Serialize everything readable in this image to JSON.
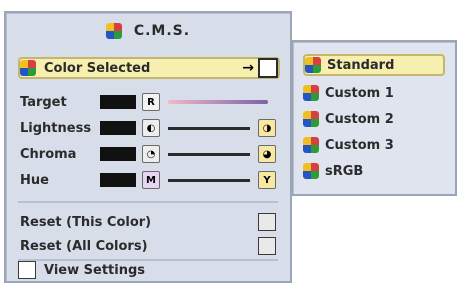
{
  "cms": {
    "title": "C.M.S.",
    "color_selected_label": "Color Selected",
    "arrow": "→",
    "params": [
      {
        "name": "Target",
        "badge": "R",
        "end_badge": ""
      },
      {
        "name": "Lightness",
        "badge": "◐",
        "end_badge": "◑"
      },
      {
        "name": "Chroma",
        "badge": "◔",
        "end_badge": "◕"
      },
      {
        "name": "Hue",
        "badge": "M",
        "end_badge": "Y"
      }
    ],
    "reset_this": "Reset (This Color)",
    "reset_all": "Reset (All Colors)",
    "view_settings": "View Settings"
  },
  "side_menu": {
    "items": [
      {
        "label": "Standard"
      },
      {
        "label": "Custom 1"
      },
      {
        "label": "Custom 2"
      },
      {
        "label": "Custom 3"
      },
      {
        "label": "sRGB"
      }
    ]
  }
}
